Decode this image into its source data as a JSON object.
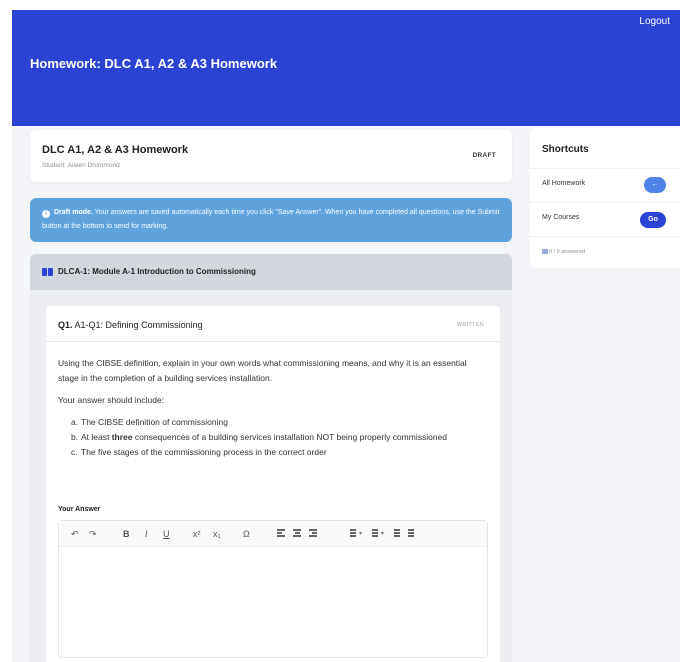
{
  "header": {
    "logout_label": "Logout",
    "page_title": "Homework: DLC A1, A2 & A3 Homework"
  },
  "homework": {
    "title": "DLC A1, A2 & A3 Homework",
    "student": "Student: Aileen Drummond",
    "status_badge": "DRAFT"
  },
  "alert": {
    "icon": "info-icon",
    "heading": "Draft mode.",
    "text": "Your answers are saved automatically each time you click \"Save Answer\". When you have completed all questions, use the Submit button at the bottom to send for marking."
  },
  "module": {
    "icon": "book-icon",
    "title": "DLCA-1: Module A-1 Introduction to Commissioning"
  },
  "question": {
    "number": "Q1.",
    "title": "A1-Q1: Defining Commissioning",
    "type": "WRITTEN",
    "paragraph_1": "Using the CIBSE definition, explain in your own words what commissioning means, and why it is an essential stage in the completion of a building services installation.",
    "paragraph_2": "Your answer should include:",
    "items": [
      {
        "marker": "a.",
        "text": "The CIBSE definition of commissioning"
      },
      {
        "marker": "b.",
        "pre": "At least ",
        "bold": "three",
        "post": " consequences of a building services installation NOT being properly commissioned"
      },
      {
        "marker": "c.",
        "text": "The five stages of the commissioning process in the correct order"
      }
    ],
    "answer_label": "Your Answer"
  },
  "editor_toolbar": {
    "undo": "↶",
    "redo": "↷",
    "bold": "B",
    "italic": "I",
    "underline": "U",
    "superscript": "x²",
    "subscript": "x₁",
    "special_char": "Ω"
  },
  "shortcuts": {
    "title": "Shortcuts",
    "items": [
      {
        "label": "All Homework",
        "button": "←"
      },
      {
        "label": "My Courses",
        "button": "Go"
      }
    ],
    "progress": "0 / 0 answered"
  }
}
